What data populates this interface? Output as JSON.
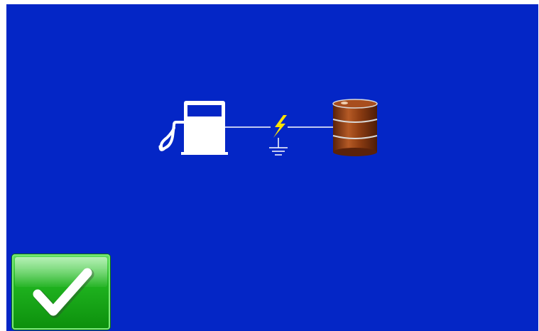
{
  "screen": {
    "background_color": "#0426c6"
  },
  "diagram": {
    "left_icon": "fuel-pump-icon",
    "middle_icon": "static-ground-icon",
    "right_icon": "oil-drum-icon",
    "pump_color": "#ffffff",
    "bolt_color": "#ffe300",
    "drum_color": "#8e3d12"
  },
  "confirm_button": {
    "icon": "checkmark-icon",
    "color": "#1fb31f"
  }
}
